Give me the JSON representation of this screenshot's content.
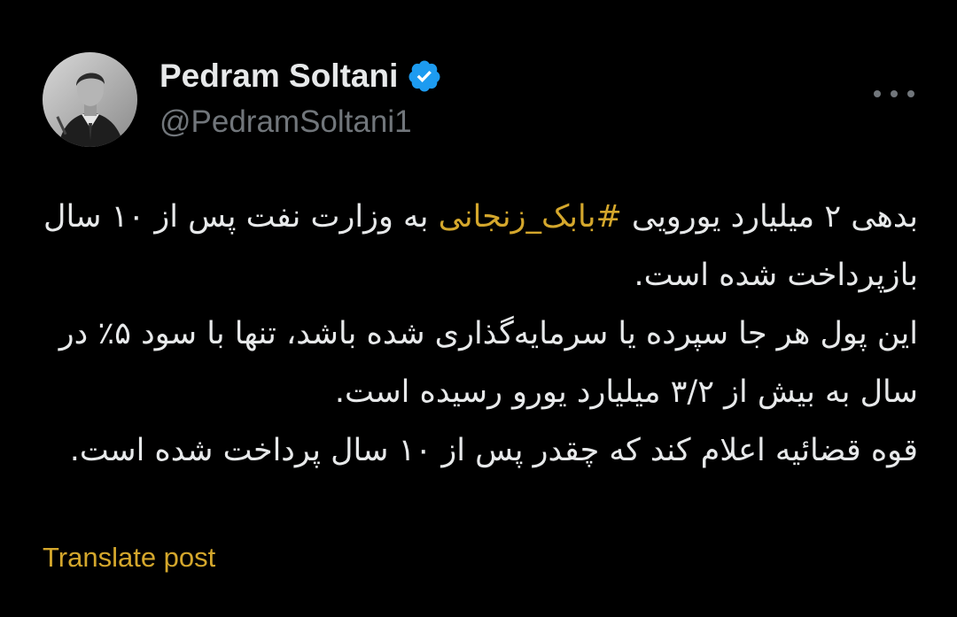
{
  "author": {
    "display_name": "Pedram Soltani",
    "handle": "@PedramSoltani1",
    "verified": true,
    "verified_badge_color": "#1d9bf0"
  },
  "menu": {
    "icon": "more-horizontal-icon"
  },
  "post": {
    "paragraph1": {
      "before": "بدهی ۲ میلیارد یورویی ",
      "hashtag": "#بابک_زنجانی",
      "after": " به وزارت نفت پس از ۱۰ سال بازپرداخت شده است."
    },
    "paragraph2": "این پول هر جا سپرده یا سرمایه‌گذاری شده باشد، تنها با سود ۵٪ در سال به بیش از ۳/۲ میلیارد یورو رسیده است.",
    "paragraph3": "قوه قضائیه اعلام کند که چقدر پس از ۱۰ سال پرداخت شده است."
  },
  "actions": {
    "translate_label": "Translate post"
  },
  "colors": {
    "background": "#000000",
    "text": "#e7e9ea",
    "secondary_text": "#71767b",
    "accent": "#d4a72c"
  }
}
